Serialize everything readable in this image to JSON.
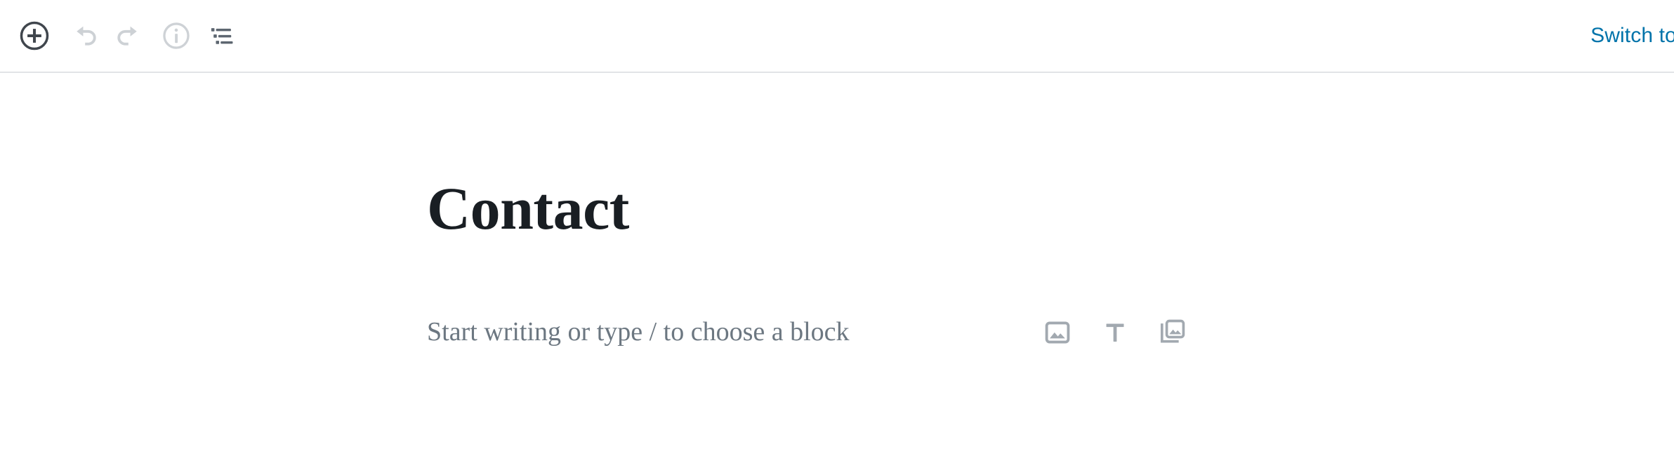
{
  "colors": {
    "toolbar_icon_active": "#40464d",
    "toolbar_icon_disabled": "#cdd1d5",
    "toolbar_icon_muted": "#ced2d6",
    "header_border": "#e2e4e7",
    "link_blue": "#0073aa",
    "title_text": "#191e23",
    "placeholder_text": "#6c7781",
    "block_icon": "#a2a9b0",
    "canvas_background": "#ffffff"
  },
  "header": {
    "tools": [
      {
        "name": "add-block-button",
        "label": "Add block",
        "icon": "plus-circle-icon",
        "state": "enabled"
      },
      {
        "name": "undo-button",
        "label": "Undo",
        "icon": "undo-icon",
        "state": "disabled"
      },
      {
        "name": "redo-button",
        "label": "Redo",
        "icon": "redo-icon",
        "state": "disabled"
      },
      {
        "name": "details-button",
        "label": "Details",
        "icon": "info-circle-icon",
        "state": "enabled"
      },
      {
        "name": "list-view-button",
        "label": "List view",
        "icon": "list-view-icon",
        "state": "enabled"
      }
    ],
    "switch_link_label": "Switch to D"
  },
  "content": {
    "post_title": "Contact",
    "paragraph_placeholder": "Start writing or type / to choose a block",
    "block_shortcuts": [
      {
        "name": "insert-image-block-button",
        "label": "Image",
        "icon": "image-icon"
      },
      {
        "name": "insert-paragraph-block-button",
        "label": "Paragraph",
        "icon": "text-t-icon"
      },
      {
        "name": "insert-gallery-block-button",
        "label": "Gallery",
        "icon": "gallery-icon"
      }
    ]
  }
}
